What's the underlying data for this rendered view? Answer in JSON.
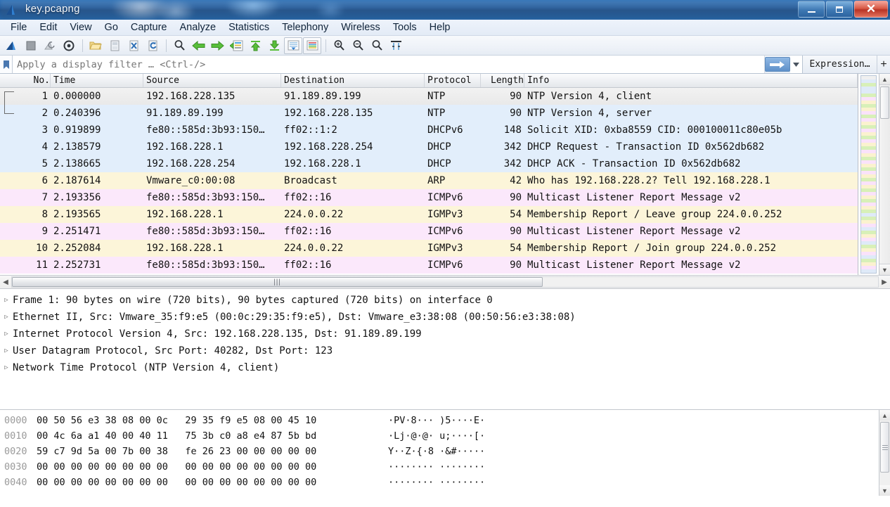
{
  "window": {
    "title": "key.pcapng",
    "minimize_label": "Minimize",
    "maximize_label": "Restore",
    "close_label": "✕"
  },
  "menu": {
    "items": [
      {
        "label": "File"
      },
      {
        "label": "Edit"
      },
      {
        "label": "View"
      },
      {
        "label": "Go"
      },
      {
        "label": "Capture"
      },
      {
        "label": "Analyze"
      },
      {
        "label": "Statistics"
      },
      {
        "label": "Telephony"
      },
      {
        "label": "Wireless"
      },
      {
        "label": "Tools"
      },
      {
        "label": "Help"
      }
    ]
  },
  "toolbar": {
    "buttons": [
      {
        "name": "start-capture-icon",
        "title": "Start capturing packets"
      },
      {
        "name": "stop-capture-icon",
        "title": "Stop capturing packets"
      },
      {
        "name": "restart-capture-icon",
        "title": "Restart current capture"
      },
      {
        "name": "capture-options-icon",
        "title": "Capture options"
      },
      {
        "name": "open-file-icon",
        "title": "Open a capture file"
      },
      {
        "name": "save-file-icon",
        "title": "Save this capture file"
      },
      {
        "name": "close-file-icon",
        "title": "Close this capture file"
      },
      {
        "name": "reload-file-icon",
        "title": "Reload this file"
      },
      {
        "name": "find-packet-icon",
        "title": "Find a packet"
      },
      {
        "name": "go-back-icon",
        "title": "Go back in packet history"
      },
      {
        "name": "go-forward-icon",
        "title": "Go forward in packet history"
      },
      {
        "name": "go-to-packet-icon",
        "title": "Go to the packet with number"
      },
      {
        "name": "go-to-first-icon",
        "title": "Go to the first packet"
      },
      {
        "name": "go-to-last-icon",
        "title": "Go to the last packet"
      },
      {
        "name": "auto-scroll-icon",
        "title": "Auto scroll in live capture"
      },
      {
        "name": "colorize-icon",
        "title": "Colorize packet list"
      },
      {
        "name": "zoom-in-icon",
        "title": "Zoom in"
      },
      {
        "name": "zoom-out-icon",
        "title": "Zoom out"
      },
      {
        "name": "normal-size-icon",
        "title": "Normal size"
      },
      {
        "name": "resize-columns-icon",
        "title": "Resize columns"
      }
    ]
  },
  "filter": {
    "placeholder": "Apply a display filter … <Ctrl-/>",
    "value": "",
    "bookmark_icon": "bookmark-icon",
    "apply_icon": "arrow-right-icon",
    "dropdown_icon": "chevron-down-icon",
    "expression_label": "Expression…",
    "plus_label": "+"
  },
  "packet_list": {
    "columns": [
      {
        "key": "no",
        "label": "No."
      },
      {
        "key": "time",
        "label": "Time"
      },
      {
        "key": "source",
        "label": "Source"
      },
      {
        "key": "destination",
        "label": "Destination"
      },
      {
        "key": "protocol",
        "label": "Protocol"
      },
      {
        "key": "length",
        "label": "Length"
      },
      {
        "key": "info",
        "label": "Info"
      }
    ],
    "rows": [
      {
        "no": "1",
        "time": "0.000000",
        "source": "192.168.228.135",
        "destination": "91.189.89.199",
        "protocol": "NTP",
        "length": "90",
        "info": "NTP Version 4, client",
        "style": "rw-sel"
      },
      {
        "no": "2",
        "time": "0.240396",
        "source": "91.189.89.199",
        "destination": "192.168.228.135",
        "protocol": "NTP",
        "length": "90",
        "info": "NTP Version 4, server",
        "style": "rw-blue"
      },
      {
        "no": "3",
        "time": "0.919899",
        "source": "fe80::585d:3b93:150…",
        "destination": "ff02::1:2",
        "protocol": "DHCPv6",
        "length": "148",
        "info": "Solicit XID: 0xba8559 CID: 000100011c80e05b",
        "style": "rw-blue"
      },
      {
        "no": "4",
        "time": "2.138579",
        "source": "192.168.228.1",
        "destination": "192.168.228.254",
        "protocol": "DHCP",
        "length": "342",
        "info": "DHCP Request  - Transaction ID 0x562db682",
        "style": "rw-blue"
      },
      {
        "no": "5",
        "time": "2.138665",
        "source": "192.168.228.254",
        "destination": "192.168.228.1",
        "protocol": "DHCP",
        "length": "342",
        "info": "DHCP ACK      - Transaction ID 0x562db682",
        "style": "rw-blue"
      },
      {
        "no": "6",
        "time": "2.187614",
        "source": "Vmware_c0:00:08",
        "destination": "Broadcast",
        "protocol": "ARP",
        "length": "42",
        "info": "Who has 192.168.228.2? Tell 192.168.228.1",
        "style": "rw-cream"
      },
      {
        "no": "7",
        "time": "2.193356",
        "source": "fe80::585d:3b93:150…",
        "destination": "ff02::16",
        "protocol": "ICMPv6",
        "length": "90",
        "info": "Multicast Listener Report Message v2",
        "style": "rw-pink"
      },
      {
        "no": "8",
        "time": "2.193565",
        "source": "192.168.228.1",
        "destination": "224.0.0.22",
        "protocol": "IGMPv3",
        "length": "54",
        "info": "Membership Report / Leave group 224.0.0.252",
        "style": "rw-cream"
      },
      {
        "no": "9",
        "time": "2.251471",
        "source": "fe80::585d:3b93:150…",
        "destination": "ff02::16",
        "protocol": "ICMPv6",
        "length": "90",
        "info": "Multicast Listener Report Message v2",
        "style": "rw-pink"
      },
      {
        "no": "10",
        "time": "2.252084",
        "source": "192.168.228.1",
        "destination": "224.0.0.22",
        "protocol": "IGMPv3",
        "length": "54",
        "info": "Membership Report / Join group 224.0.0.252",
        "style": "rw-cream"
      },
      {
        "no": "11",
        "time": "2.252731",
        "source": "fe80::585d:3b93:150…",
        "destination": "ff02::16",
        "protocol": "ICMPv6",
        "length": "90",
        "info": "Multicast Listener Report Message v2",
        "style": "rw-pink"
      }
    ]
  },
  "packet_details": {
    "rows": [
      {
        "text": "Frame 1: 90 bytes on wire (720 bits), 90 bytes captured (720 bits) on interface 0"
      },
      {
        "text": "Ethernet II, Src: Vmware_35:f9:e5 (00:0c:29:35:f9:e5), Dst: Vmware_e3:38:08 (00:50:56:e3:38:08)"
      },
      {
        "text": "Internet Protocol Version 4, Src: 192.168.228.135, Dst: 91.189.89.199"
      },
      {
        "text": "User Datagram Protocol, Src Port: 40282, Dst Port: 123"
      },
      {
        "text": "Network Time Protocol (NTP Version 4, client)"
      }
    ]
  },
  "packet_bytes": {
    "rows": [
      {
        "offset": "0000",
        "bytes": "00 50 56 e3 38 08 00 0c   29 35 f9 e5 08 00 45 10",
        "ascii": "·PV·8··· )5····E·"
      },
      {
        "offset": "0010",
        "bytes": "00 4c 6a a1 40 00 40 11   75 3b c0 a8 e4 87 5b bd",
        "ascii": "·Lj·@·@· u;····[·"
      },
      {
        "offset": "0020",
        "bytes": "59 c7 9d 5a 00 7b 00 38   fe 26 23 00 00 00 00 00",
        "ascii": "Y··Z·{·8 ·&#·····"
      },
      {
        "offset": "0030",
        "bytes": "00 00 00 00 00 00 00 00   00 00 00 00 00 00 00 00",
        "ascii": "········ ········"
      },
      {
        "offset": "0040",
        "bytes": "00 00 00 00 00 00 00 00   00 00 00 00 00 00 00 00",
        "ascii": "········ ········"
      }
    ]
  },
  "colors": {
    "selected_row": "#eeeeee",
    "tcp_udp_row": "#e2eefb",
    "arp_igmp_row": "#fcf5d9",
    "icmpv6_row": "#fbe8fb",
    "titlebar": "#1f5a9e",
    "accent": "#5f90c9"
  }
}
